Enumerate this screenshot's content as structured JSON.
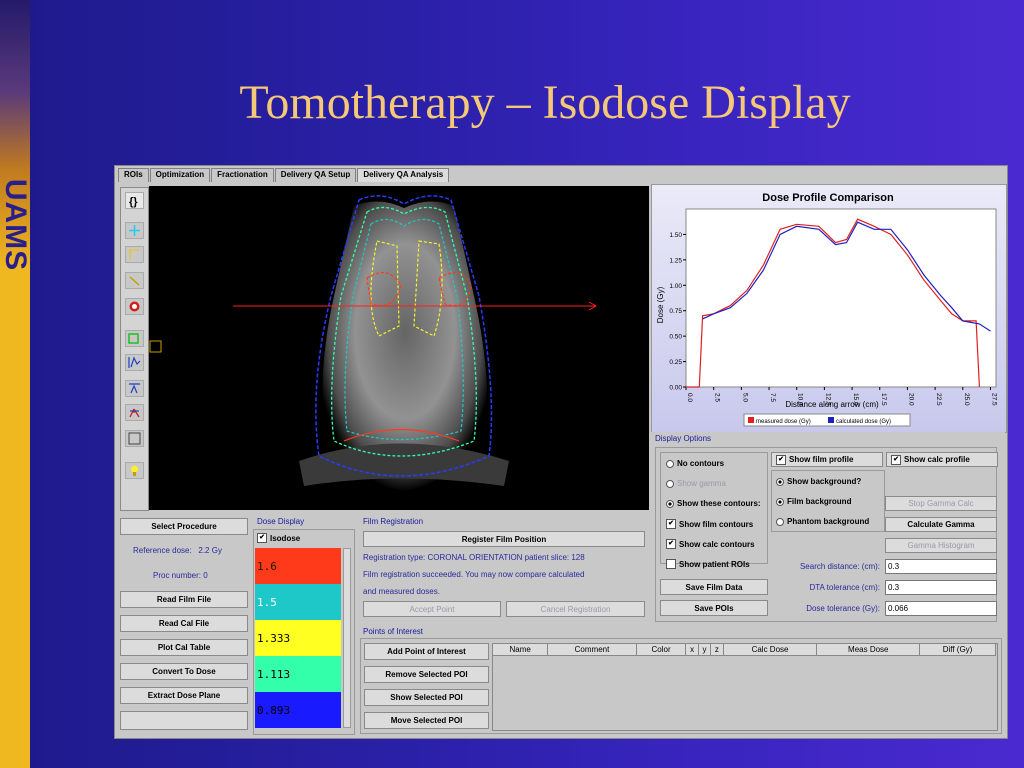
{
  "slide": {
    "title": "Tomotherapy – Isodose Display",
    "logo_text": "UAMS"
  },
  "tabs": [
    "ROIs",
    "Optimization",
    "Fractionation",
    "Delivery QA Setup",
    "Delivery QA Analysis"
  ],
  "active_tab": 4,
  "toolbar_icons": [
    "rotate-icon",
    "crosshair-icon",
    "ruler-icon",
    "line-icon",
    "target-icon",
    "roi-icon",
    "profile-icon",
    "profile-alt-icon",
    "fork-icon",
    "square-icon",
    "light-icon"
  ],
  "left_panel": {
    "select_procedure": "Select Procedure",
    "reference_dose_label": "Reference dose:",
    "reference_dose_value": "2.2 Gy",
    "proc_number": "Proc number: 0",
    "buttons": [
      "Read Film File",
      "Read Cal File",
      "Plot Cal Table",
      "Convert To Dose",
      "Extract Dose Plane"
    ]
  },
  "dose_display": {
    "title": "Dose Display",
    "isodose_label": "Isodose",
    "isodose_checked": true,
    "levels": [
      {
        "value": "1.6",
        "color": "#ff3a1a",
        "text_color": "#1a1a00"
      },
      {
        "value": "1.5",
        "color": "#1ec8c8",
        "text_color": "#ffffff"
      },
      {
        "value": "1.333",
        "color": "#ffff22",
        "text_color": "#000000"
      },
      {
        "value": "1.113",
        "color": "#33ffaa",
        "text_color": "#000000"
      },
      {
        "value": "0.893",
        "color": "#1a1aff",
        "text_color": "#000000"
      }
    ]
  },
  "film_registration": {
    "title": "Film Registration",
    "register_button": "Register Film Position",
    "lines": [
      "Registration type: CORONAL ORIENTATION patient slice: 128",
      "Film registration succeeded. You may now compare calculated",
      "and measured doses."
    ],
    "accept_point": "Accept Point",
    "cancel_registration": "Cancel Registration"
  },
  "points_of_interest": {
    "title": "Points of Interest",
    "buttons": [
      "Add Point of Interest",
      "Remove Selected POI",
      "Show Selected POI",
      "Move Selected POI"
    ],
    "columns": [
      "Name",
      "Comment",
      "Color",
      "x",
      "y",
      "z",
      "Calc Dose",
      "Meas Dose",
      "Diff (Gy)"
    ]
  },
  "display_options": {
    "title": "Display Options",
    "contour_radios": [
      "No contours",
      "Show gamma",
      "Show these contours:"
    ],
    "contour_selected": 2,
    "contour_checks": [
      "Show film contours",
      "Show calc contours",
      "Show patient ROIs"
    ],
    "contour_checked": [
      true,
      true,
      false
    ],
    "show_film_profile": "Show film profile",
    "show_calc_profile": "Show calc profile",
    "bg_radios": [
      "Show background?",
      "Film background",
      "Phantom background"
    ],
    "bg_selected": [
      true,
      true,
      false
    ],
    "stop_gamma": "Stop Gamma Calc",
    "calculate_gamma": "Calculate Gamma",
    "gamma_histogram": "Gamma Histogram",
    "save_film_data": "Save Film Data",
    "save_pois": "Save POIs",
    "search_distance_label": "Search distance: (cm):",
    "search_distance_value": "0.3",
    "dta_label": "DTA tolerance (cm):",
    "dta_value": "0.3",
    "dose_tol_label": "Dose tolerance (Gy):",
    "dose_tol_value": "0.066"
  },
  "chart_data": {
    "type": "line",
    "title": "Dose Profile Comparison",
    "xlabel": "Distance along arrow (cm)",
    "ylabel": "Dose (Gy)",
    "xlim": [
      0,
      28
    ],
    "ylim": [
      0,
      1.75
    ],
    "xticks": [
      "0.0",
      "2.5",
      "5.0",
      "7.5",
      "10.0",
      "12.5",
      "15.0",
      "17.5",
      "20.0",
      "22.5",
      "25.0",
      "27.5"
    ],
    "yticks": [
      "0.00",
      "0.25",
      "0.50",
      "0.75",
      "1.00",
      "1.25",
      "1.50"
    ],
    "series": [
      {
        "name": "measured dose (Gy)",
        "color": "#e02020",
        "points": [
          [
            0,
            0
          ],
          [
            1.2,
            0
          ],
          [
            1.5,
            0.7
          ],
          [
            2.5,
            0.72
          ],
          [
            4,
            0.8
          ],
          [
            5.5,
            0.95
          ],
          [
            7,
            1.2
          ],
          [
            8.5,
            1.55
          ],
          [
            10,
            1.6
          ],
          [
            12,
            1.58
          ],
          [
            13.5,
            1.42
          ],
          [
            14.5,
            1.45
          ],
          [
            15.5,
            1.65
          ],
          [
            17,
            1.58
          ],
          [
            18.5,
            1.5
          ],
          [
            20,
            1.3
          ],
          [
            21.5,
            1.05
          ],
          [
            23,
            0.85
          ],
          [
            24,
            0.72
          ],
          [
            25,
            0.65
          ],
          [
            26.2,
            0.65
          ],
          [
            26.5,
            0
          ]
        ]
      },
      {
        "name": "calculated dose (Gy)",
        "color": "#2020c0",
        "points": [
          [
            1.5,
            0.67
          ],
          [
            2.5,
            0.72
          ],
          [
            4,
            0.78
          ],
          [
            5.5,
            0.92
          ],
          [
            7,
            1.15
          ],
          [
            8.5,
            1.5
          ],
          [
            10,
            1.58
          ],
          [
            12,
            1.55
          ],
          [
            13.5,
            1.4
          ],
          [
            14.5,
            1.42
          ],
          [
            15.5,
            1.62
          ],
          [
            17,
            1.55
          ],
          [
            18.5,
            1.55
          ],
          [
            20,
            1.35
          ],
          [
            21.5,
            1.1
          ],
          [
            23,
            0.9
          ],
          [
            24,
            0.78
          ],
          [
            25,
            0.65
          ],
          [
            26.5,
            0.62
          ],
          [
            27.5,
            0.55
          ]
        ]
      }
    ]
  }
}
